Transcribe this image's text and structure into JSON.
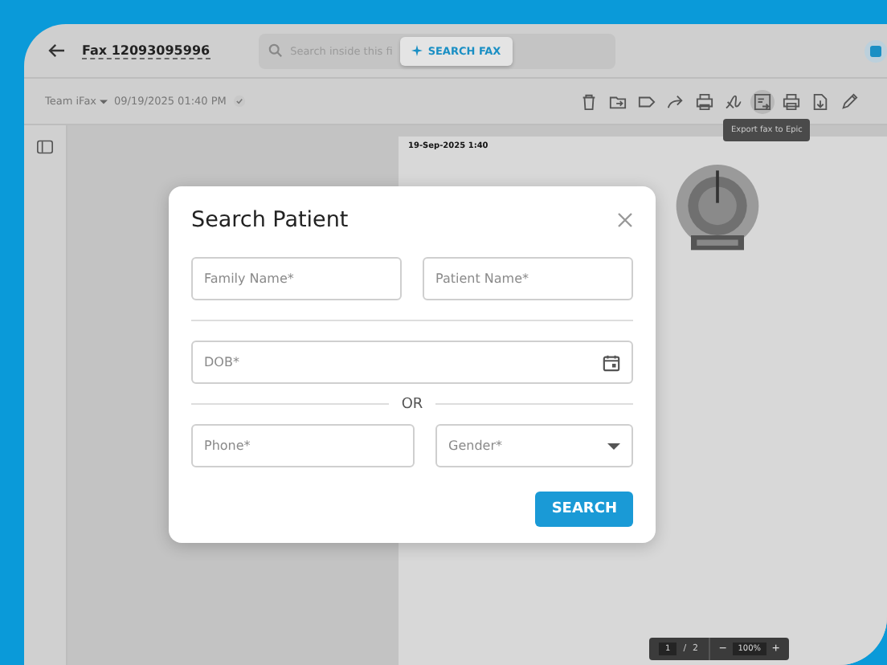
{
  "header": {
    "title": "Fax 12093095996",
    "search": {
      "placeholder": "Search inside this fi"
    },
    "search_button": "SEARCH FAX"
  },
  "toolbar": {
    "team": "Team iFax",
    "date": "09/19/2025 01:40 PM",
    "tools": [
      {
        "kind": "trash",
        "selected": false
      },
      {
        "kind": "folder",
        "selected": false
      },
      {
        "kind": "tag",
        "selected": false
      },
      {
        "kind": "forward",
        "selected": false
      },
      {
        "kind": "refax",
        "selected": false
      },
      {
        "kind": "sign",
        "selected": false
      },
      {
        "kind": "export",
        "selected": true
      },
      {
        "kind": "print",
        "selected": false
      },
      {
        "kind": "download",
        "selected": false
      },
      {
        "kind": "edit",
        "selected": false
      }
    ],
    "tooltip": "Export fax to Epic"
  },
  "document": {
    "timestamp": "19-Sep-2025 1:40"
  },
  "modal": {
    "title": "Search Patient",
    "rows": [
      {
        "fields": [
          {
            "kind": "text",
            "placeholder": "Family Name*"
          },
          {
            "kind": "text",
            "placeholder": "Patient Name*"
          }
        ]
      },
      {
        "fields": [
          {
            "kind": "date",
            "placeholder": "DOB*"
          }
        ]
      },
      {
        "divider_label": "OR",
        "fields": [
          {
            "kind": "text",
            "placeholder": "Phone*"
          },
          {
            "kind": "select",
            "placeholder": "Gender*"
          }
        ]
      }
    ],
    "button": "SEARCH"
  },
  "pager": {
    "page": "1",
    "separator": "/",
    "total": "2",
    "zoom_out": "−",
    "zoom": "100%",
    "zoom_in": "+"
  }
}
